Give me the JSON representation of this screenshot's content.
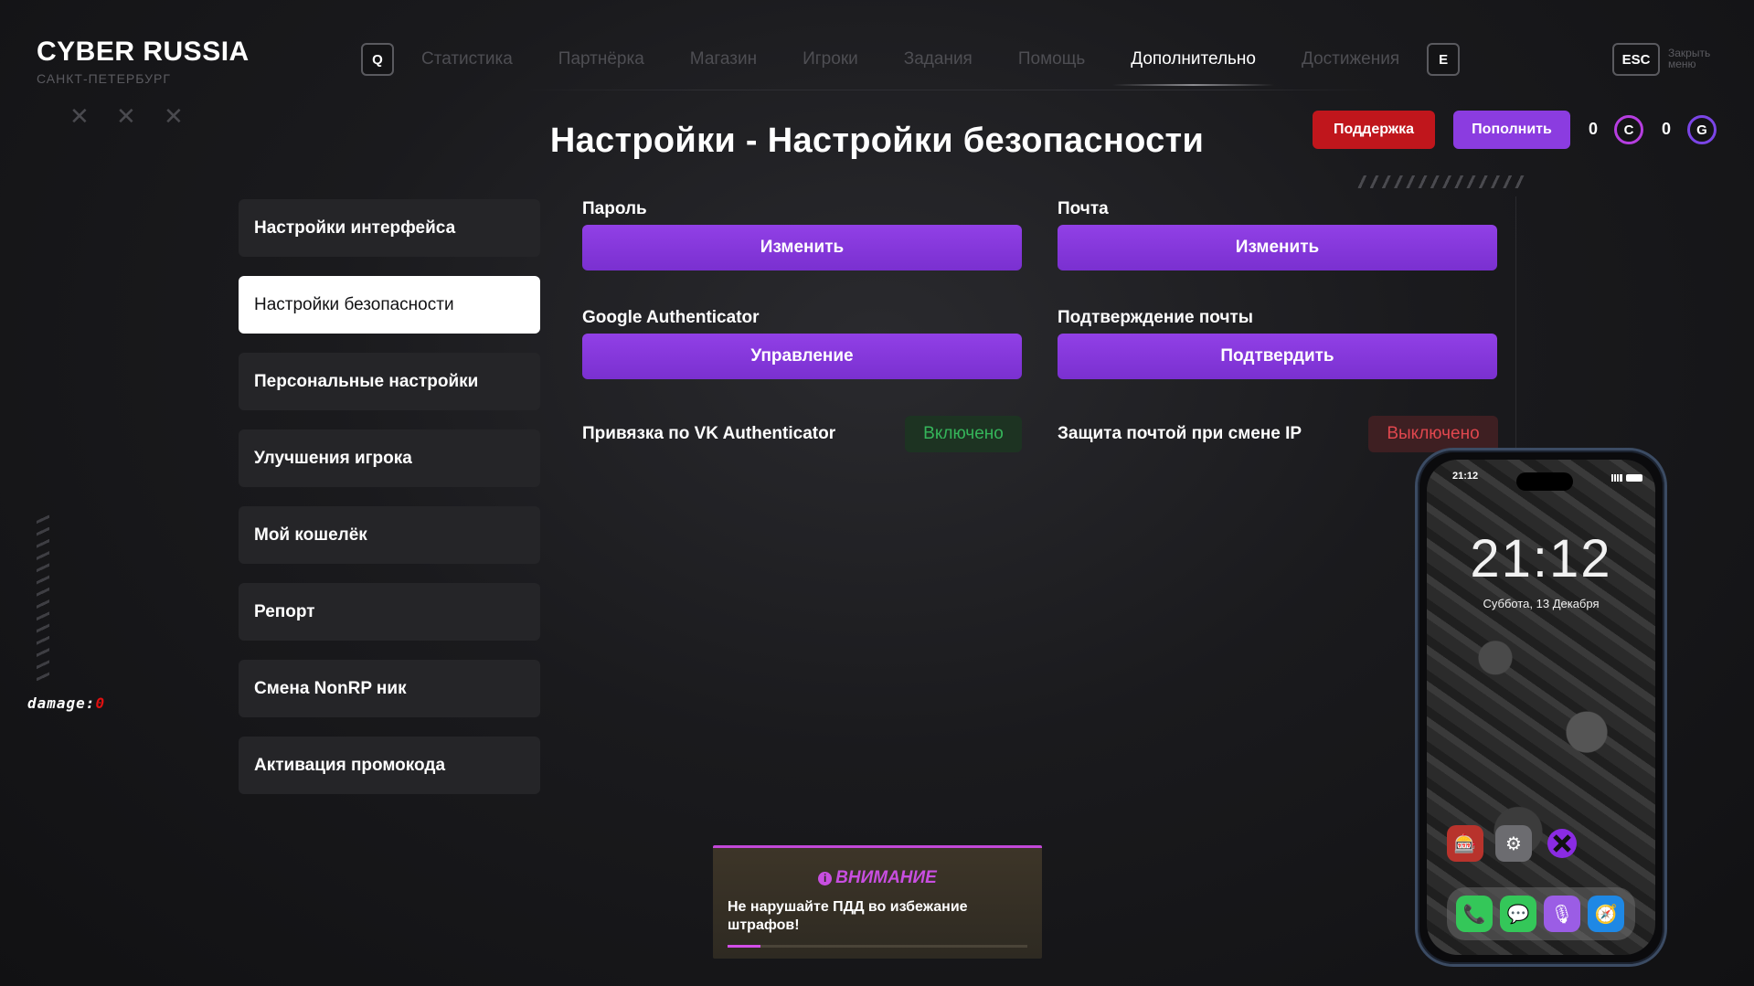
{
  "brand": {
    "title": "CYBER RUSSIA",
    "subtitle": "САНКТ-ПЕТЕРБУРГ",
    "marks": [
      "✕",
      "✕",
      "✕"
    ]
  },
  "nav": {
    "left_key": "Q",
    "right_key": "E",
    "items": [
      "Статистика",
      "Партнёрка",
      "Магазин",
      "Игроки",
      "Задания",
      "Помощь",
      "Дополнительно",
      "Достижения"
    ],
    "active_index": 6,
    "esc_key": "ESC",
    "esc_label": "Закрыть меню"
  },
  "header": {
    "support_label": "Поддержка",
    "topup_label": "Пополнить",
    "currency_c": {
      "count": "0",
      "symbol": "C",
      "color": "#b63ee0"
    },
    "currency_g": {
      "count": "0",
      "symbol": "G",
      "color": "#7b45e6"
    }
  },
  "page_title": "Настройки - Настройки безопасности",
  "sidebar": {
    "items": [
      "Настройки интерфейса",
      "Настройки безопасности",
      "Персональные настройки",
      "Улучшения игрока",
      "Мой кошелёк",
      "Репорт",
      "Смена NonRP ник",
      "Активация промокода"
    ],
    "active_index": 1
  },
  "security": {
    "password": {
      "label": "Пароль",
      "button": "Изменить"
    },
    "email": {
      "label": "Почта",
      "button": "Изменить"
    },
    "google_auth": {
      "label": "Google Authenticator",
      "button": "Управление"
    },
    "email_confirm": {
      "label": "Подтверждение почты",
      "button": "Подтвердить"
    },
    "vk_auth": {
      "label": "Привязка по VK Authenticator",
      "status": "Включено",
      "status_color": "#35b55a"
    },
    "ip_protection": {
      "label": "Защита почтой при смене IP",
      "status": "Выключено",
      "status_color": "#e0474e"
    }
  },
  "hud": {
    "damage_label": "damage:",
    "damage_value": "0"
  },
  "notice": {
    "icon": "info-icon",
    "title": "ВНИМАНИЕ",
    "text": "Не нарушайте ПДД во избежание штрафов!",
    "progress": 0.11,
    "accent": "#c84ee0"
  },
  "phone": {
    "status_time": "21:12",
    "clock": "21:12",
    "date": "Суббота, 13 Декабря",
    "apps": [
      "casino-icon",
      "settings-icon",
      "x-app-icon"
    ],
    "dock": [
      "phone-icon",
      "messages-icon",
      "podcasts-icon",
      "safari-icon"
    ]
  }
}
